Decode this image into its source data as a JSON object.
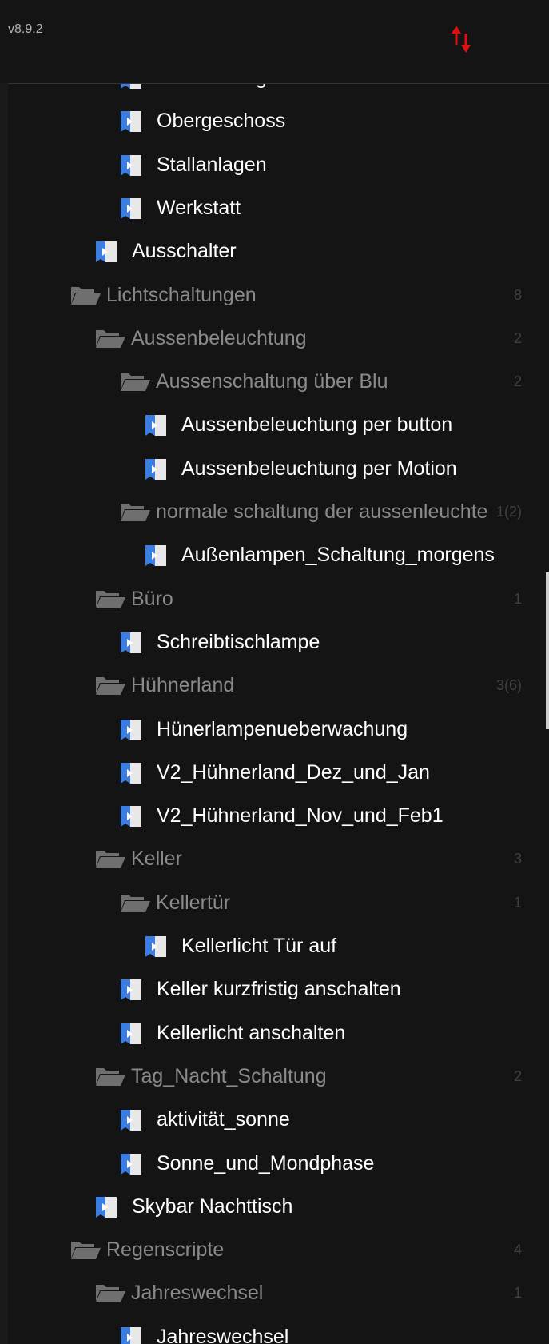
{
  "header": {
    "version": "v8.9.2",
    "sort_icon": "sort-arrows-icon",
    "accent": "#e01010"
  },
  "colors": {
    "script_icon": "#3b7de0",
    "folder_icon": "#6f6f6f",
    "script_text": "#ffffff",
    "folder_text": "#8a8a8a"
  },
  "tree": {
    "items": [
      {
        "type": "script",
        "label": "Gartenanlage",
        "count": ""
      },
      {
        "type": "script",
        "label": "Obergeschoss",
        "count": ""
      },
      {
        "type": "script",
        "label": "Stallanlagen",
        "count": ""
      },
      {
        "type": "script",
        "label": "Werkstatt",
        "count": ""
      },
      {
        "type": "script",
        "label": "Ausschalter",
        "count": ""
      },
      {
        "type": "folder",
        "label": "Lichtschaltungen",
        "count": "8"
      },
      {
        "type": "folder",
        "label": "Aussenbeleuchtung",
        "count": "2"
      },
      {
        "type": "folder",
        "label": "Aussenschaltung über Blu",
        "count": "2"
      },
      {
        "type": "script",
        "label": "Aussenbeleuchtung per button",
        "count": ""
      },
      {
        "type": "script",
        "label": "Aussenbeleuchtung per Motion",
        "count": ""
      },
      {
        "type": "folder",
        "label": "normale schaltung der aussenleuchte",
        "count": "1(2)"
      },
      {
        "type": "script",
        "label": "Außenlampen_Schaltung_morgens",
        "count": ""
      },
      {
        "type": "folder",
        "label": "Büro",
        "count": "1"
      },
      {
        "type": "script",
        "label": "Schreibtischlampe",
        "count": ""
      },
      {
        "type": "folder",
        "label": "Hühnerland",
        "count": "3(6)"
      },
      {
        "type": "script",
        "label": "Hünerlampenueberwachung",
        "count": ""
      },
      {
        "type": "script",
        "label": "V2_Hühnerland_Dez_und_Jan",
        "count": ""
      },
      {
        "type": "script",
        "label": "V2_Hühnerland_Nov_und_Feb1",
        "count": ""
      },
      {
        "type": "folder",
        "label": "Keller",
        "count": "3"
      },
      {
        "type": "folder",
        "label": "Kellertür",
        "count": "1"
      },
      {
        "type": "script",
        "label": "Kellerlicht Tür auf",
        "count": ""
      },
      {
        "type": "script",
        "label": "Keller kurzfristig anschalten",
        "count": ""
      },
      {
        "type": "script",
        "label": "Kellerlicht anschalten",
        "count": ""
      },
      {
        "type": "folder",
        "label": "Tag_Nacht_Schaltung",
        "count": "2"
      },
      {
        "type": "script",
        "label": "aktivität_sonne",
        "count": ""
      },
      {
        "type": "script",
        "label": "Sonne_und_Mondphase",
        "count": ""
      },
      {
        "type": "script",
        "label": "Skybar Nachttisch",
        "count": ""
      },
      {
        "type": "folder",
        "label": "Regenscripte",
        "count": "4"
      },
      {
        "type": "folder",
        "label": "Jahreswechsel",
        "count": "1"
      },
      {
        "type": "script",
        "label": "Jahreswechsel",
        "count": ""
      }
    ]
  }
}
